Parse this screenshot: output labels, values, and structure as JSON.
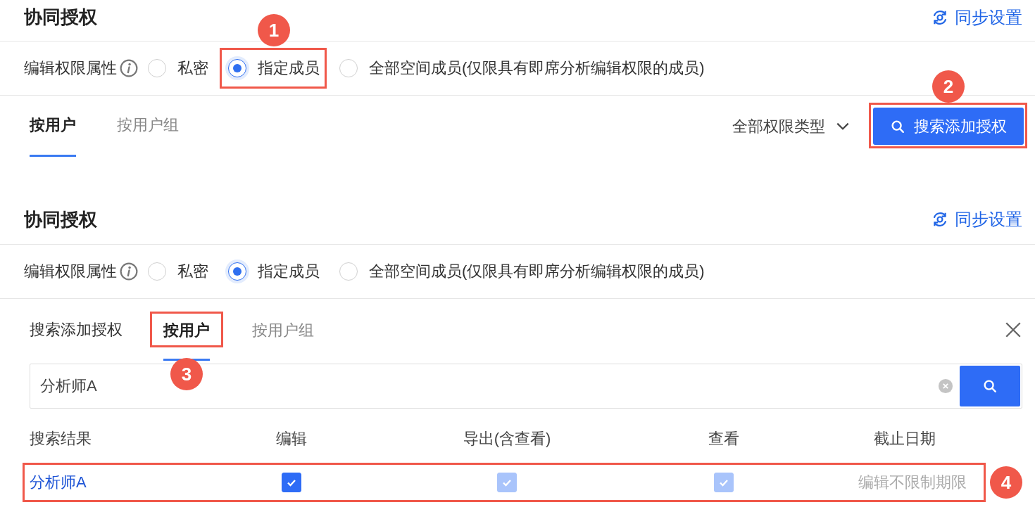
{
  "panels": [
    {
      "kind": "list",
      "title": "协同授权",
      "sync_link": "同步设置",
      "permission": {
        "label": "编辑权限属性",
        "options": [
          {
            "label": "私密",
            "selected": false
          },
          {
            "label": "指定成员",
            "selected": true,
            "callout": "1"
          },
          {
            "label": "全部空间成员(仅限具有即席分析编辑权限的成员)",
            "selected": false
          }
        ]
      },
      "tabs": [
        {
          "label": "按用户",
          "selected": true
        },
        {
          "label": "按用户组",
          "selected": false
        }
      ],
      "filter": "全部权限类型",
      "add_button": {
        "label": "搜索添加授权",
        "callout": "2"
      }
    },
    {
      "kind": "search",
      "title": "协同授权",
      "sync_link": "同步设置",
      "permission": {
        "label": "编辑权限属性",
        "options": [
          {
            "label": "私密",
            "selected": false
          },
          {
            "label": "指定成员",
            "selected": true
          },
          {
            "label": "全部空间成员(仅限具有即席分析编辑权限的成员)",
            "selected": false
          }
        ]
      },
      "search_title": "搜索添加授权",
      "tabs": [
        {
          "label": "按用户",
          "selected": true,
          "callout": "3"
        },
        {
          "label": "按用户组",
          "selected": false
        }
      ],
      "search": {
        "value": "分析师A"
      },
      "columns": [
        "搜索结果",
        "编辑",
        "导出(含查看)",
        "查看",
        "截止日期"
      ],
      "rows": [
        {
          "name": "分析师A",
          "permissions": [
            {
              "checked": true,
              "disabled": false
            },
            {
              "checked": true,
              "disabled": true
            },
            {
              "checked": true,
              "disabled": true
            }
          ],
          "deadline": "编辑不限制期限",
          "callout": "4"
        }
      ]
    }
  ]
}
